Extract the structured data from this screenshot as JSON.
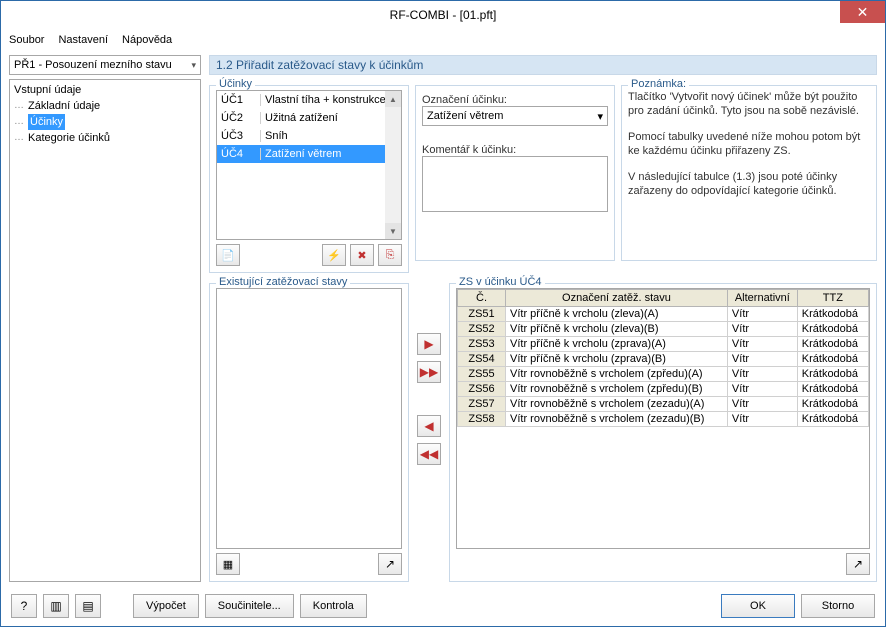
{
  "window": {
    "title": "RF-COMBI - [01.pft]"
  },
  "menu": {
    "file": "Soubor",
    "settings": "Nastavení",
    "help": "Nápověda"
  },
  "left": {
    "combo": "PŘ1 - Posouzení mezního stavu",
    "tree": {
      "root": "Vstupní údaje",
      "items": [
        "Základní údaje",
        "Účinky",
        "Kategorie účinků"
      ],
      "selected_index": 1
    }
  },
  "section_title": "1.2 Přiřadit zatěžovací stavy k účinkům",
  "ucinky": {
    "label": "Účinky",
    "rows": [
      {
        "id": "ÚČ1",
        "name": "Vlastní tíha + konstrukce střec"
      },
      {
        "id": "ÚČ2",
        "name": "Užitná zatížení"
      },
      {
        "id": "ÚČ3",
        "name": "Sníh"
      },
      {
        "id": "ÚČ4",
        "name": "Zatížení větrem"
      }
    ],
    "selected_index": 3
  },
  "mid": {
    "lbl_oznaceni": "Označení účinku:",
    "val_oznaceni": "Zatížení větrem",
    "lbl_komentar": "Komentář k účinku:",
    "val_komentar": ""
  },
  "note": {
    "label": "Poznámka:",
    "p1": "Tlačítko 'Vytvořit nový účinek' může být použito pro zadání účinků. Tyto jsou na sobě nezávislé.",
    "p2": "Pomocí tabulky uvedené níže mohou potom být ke každému účinku přiřazeny ZS.",
    "p3": "V následující tabulce (1.3) jsou poté účinky zařazeny do odpovídající kategorie účinků."
  },
  "existing": {
    "label": "Existující zatěžovací stavy"
  },
  "zs": {
    "label": "ZS v účinku ÚČ4",
    "headers": {
      "num": "Č.",
      "name": "Označení zatěž. stavu",
      "alt": "Alternativní",
      "ttz": "TTZ"
    },
    "rows": [
      {
        "num": "ZS51",
        "name": "Vítr příčně k vrcholu (zleva)(A)",
        "alt": "Vítr",
        "ttz": "Krátkodobá"
      },
      {
        "num": "ZS52",
        "name": "Vítr příčně k vrcholu (zleva)(B)",
        "alt": "Vítr",
        "ttz": "Krátkodobá"
      },
      {
        "num": "ZS53",
        "name": "Vítr příčně k vrcholu (zprava)(A)",
        "alt": "Vítr",
        "ttz": "Krátkodobá"
      },
      {
        "num": "ZS54",
        "name": "Vítr příčně k vrcholu (zprava)(B)",
        "alt": "Vítr",
        "ttz": "Krátkodobá"
      },
      {
        "num": "ZS55",
        "name": "Vítr rovnoběžně s vrcholem (zpředu)(A)",
        "alt": "Vítr",
        "ttz": "Krátkodobá"
      },
      {
        "num": "ZS56",
        "name": "Vítr rovnoběžně s vrcholem (zpředu)(B)",
        "alt": "Vítr",
        "ttz": "Krátkodobá"
      },
      {
        "num": "ZS57",
        "name": "Vítr rovnoběžně s vrcholem (zezadu)(A)",
        "alt": "Vítr",
        "ttz": "Krátkodobá"
      },
      {
        "num": "ZS58",
        "name": "Vítr rovnoběžně s vrcholem (zezadu)(B)",
        "alt": "Vítr",
        "ttz": "Krátkodobá"
      }
    ]
  },
  "footer": {
    "vypocet": "Výpočet",
    "soucinitele": "Součinitele...",
    "kontrola": "Kontrola",
    "ok": "OK",
    "storno": "Storno"
  },
  "icons": {
    "new": "📄",
    "bolt": "⚡",
    "delete": "✖",
    "copy": "⎘",
    "info": "ℹ",
    "layers": "▦"
  }
}
